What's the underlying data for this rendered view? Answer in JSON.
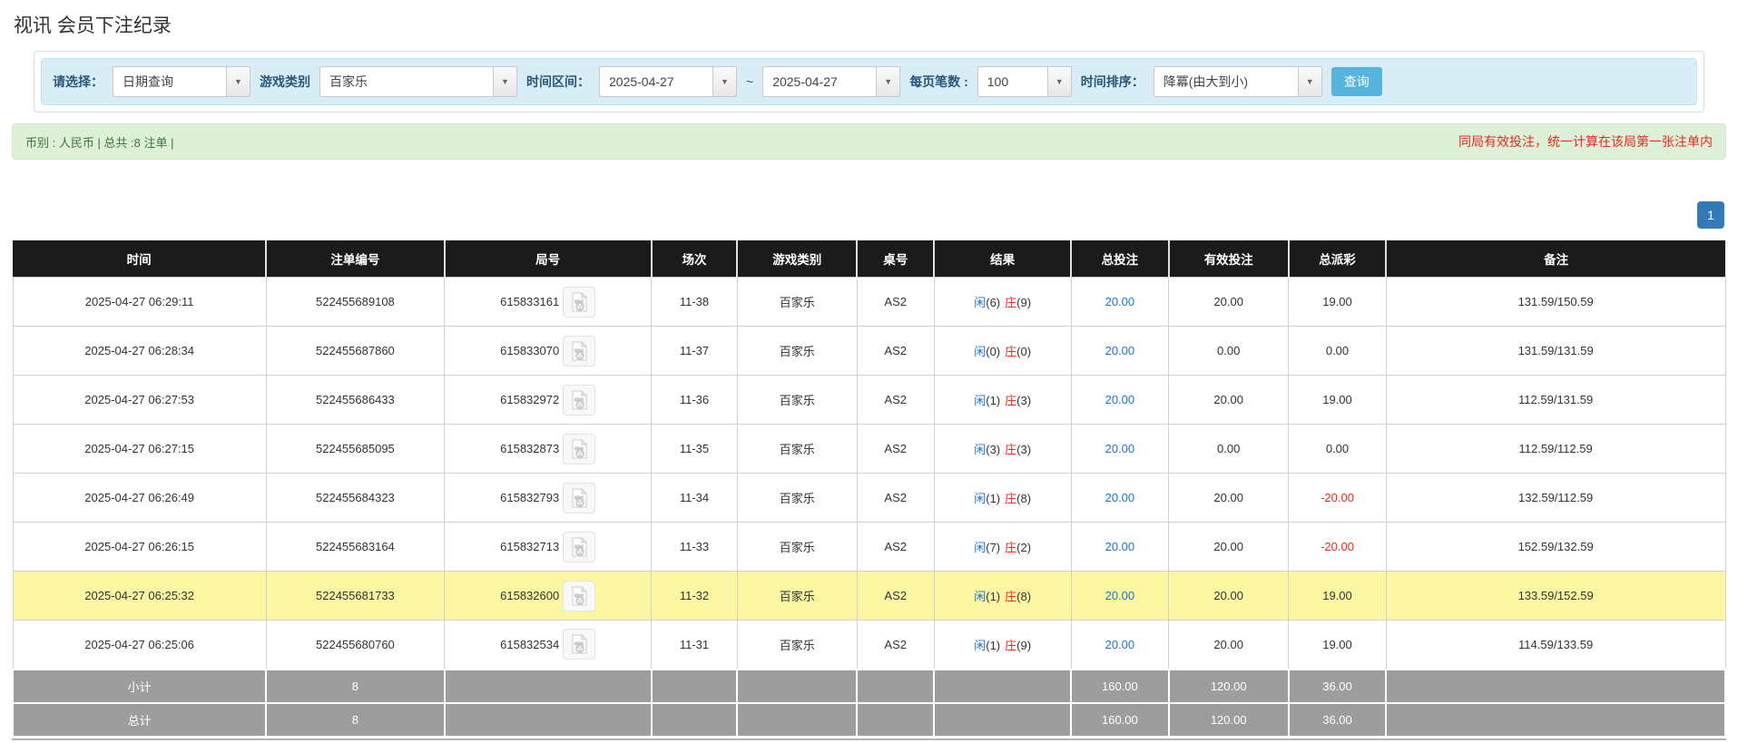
{
  "page": {
    "title": "视讯 会员下注纪录"
  },
  "filters": {
    "select_label": "请选择：",
    "select_value": "日期查询",
    "game_type_label": "游戏类别",
    "game_type_value": "百家乐",
    "time_range_label": "时间区间：",
    "date_from": "2025-04-27",
    "range_separator": "~",
    "date_to": "2025-04-27",
    "page_size_label": "每页笔数 :",
    "page_size_value": "100",
    "sort_label": "时间排序：",
    "sort_value": "降冪(由大到小)",
    "search_button": "查询",
    "dropdown_arrow": "▼"
  },
  "summary": {
    "left": "币别 : 人民币 | 总共 :8 注单 |",
    "right": "同局有效投注，统一计算在该局第一张注单内"
  },
  "pagination": {
    "current": "1"
  },
  "table": {
    "headers": [
      "时间",
      "注单编号",
      "局号",
      "场次",
      "游戏类别",
      "桌号",
      "结果",
      "总投注",
      "有效投注",
      "总派彩",
      "备注"
    ],
    "rows": [
      {
        "time": "2025-04-27 06:29:11",
        "bet_id": "522455689108",
        "round_id": "615833161",
        "session": "11-38",
        "game": "百家乐",
        "table_no": "AS2",
        "player": "闲",
        "player_score": "(6)",
        "banker": "庄",
        "banker_score": "(9)",
        "total_bet": "20.00",
        "valid_bet": "20.00",
        "payout": "19.00",
        "payout_negative": false,
        "remark": "131.59/150.59",
        "highlight": false
      },
      {
        "time": "2025-04-27 06:28:34",
        "bet_id": "522455687860",
        "round_id": "615833070",
        "session": "11-37",
        "game": "百家乐",
        "table_no": "AS2",
        "player": "闲",
        "player_score": "(0)",
        "banker": "庄",
        "banker_score": "(0)",
        "total_bet": "20.00",
        "valid_bet": "0.00",
        "payout": "0.00",
        "payout_negative": false,
        "remark": "131.59/131.59",
        "highlight": false
      },
      {
        "time": "2025-04-27 06:27:53",
        "bet_id": "522455686433",
        "round_id": "615832972",
        "session": "11-36",
        "game": "百家乐",
        "table_no": "AS2",
        "player": "闲",
        "player_score": "(1)",
        "banker": "庄",
        "banker_score": "(3)",
        "total_bet": "20.00",
        "valid_bet": "20.00",
        "payout": "19.00",
        "payout_negative": false,
        "remark": "112.59/131.59",
        "highlight": false
      },
      {
        "time": "2025-04-27 06:27:15",
        "bet_id": "522455685095",
        "round_id": "615832873",
        "session": "11-35",
        "game": "百家乐",
        "table_no": "AS2",
        "player": "闲",
        "player_score": "(3)",
        "banker": "庄",
        "banker_score": "(3)",
        "total_bet": "20.00",
        "valid_bet": "0.00",
        "payout": "0.00",
        "payout_negative": false,
        "remark": "112.59/112.59",
        "highlight": false
      },
      {
        "time": "2025-04-27 06:26:49",
        "bet_id": "522455684323",
        "round_id": "615832793",
        "session": "11-34",
        "game": "百家乐",
        "table_no": "AS2",
        "player": "闲",
        "player_score": "(1)",
        "banker": "庄",
        "banker_score": "(8)",
        "total_bet": "20.00",
        "valid_bet": "20.00",
        "payout": "-20.00",
        "payout_negative": true,
        "remark": "132.59/112.59",
        "highlight": false
      },
      {
        "time": "2025-04-27 06:26:15",
        "bet_id": "522455683164",
        "round_id": "615832713",
        "session": "11-33",
        "game": "百家乐",
        "table_no": "AS2",
        "player": "闲",
        "player_score": "(7)",
        "banker": "庄",
        "banker_score": "(2)",
        "total_bet": "20.00",
        "valid_bet": "20.00",
        "payout": "-20.00",
        "payout_negative": true,
        "remark": "152.59/132.59",
        "highlight": false
      },
      {
        "time": "2025-04-27 06:25:32",
        "bet_id": "522455681733",
        "round_id": "615832600",
        "session": "11-32",
        "game": "百家乐",
        "table_no": "AS2",
        "player": "闲",
        "player_score": "(1)",
        "banker": "庄",
        "banker_score": "(8)",
        "total_bet": "20.00",
        "valid_bet": "20.00",
        "payout": "19.00",
        "payout_negative": false,
        "remark": "133.59/152.59",
        "highlight": true
      },
      {
        "time": "2025-04-27 06:25:06",
        "bet_id": "522455680760",
        "round_id": "615832534",
        "session": "11-31",
        "game": "百家乐",
        "table_no": "AS2",
        "player": "闲",
        "player_score": "(1)",
        "banker": "庄",
        "banker_score": "(9)",
        "total_bet": "20.00",
        "valid_bet": "20.00",
        "payout": "19.00",
        "payout_negative": false,
        "remark": "114.59/133.59",
        "highlight": false
      }
    ],
    "footer": [
      {
        "label": "小计",
        "count": "8",
        "total_bet": "160.00",
        "valid_bet": "120.00",
        "payout": "36.00"
      },
      {
        "label": "总计",
        "count": "8",
        "total_bet": "160.00",
        "valid_bet": "120.00",
        "payout": "36.00"
      }
    ]
  },
  "colors": {
    "accent-blue": "#56b4dd",
    "pagination-blue": "#337ab7",
    "link-blue": "#1b74d1",
    "danger-red": "#e8291c",
    "header-bg": "#1b1b1b",
    "footer-bg": "#9d9d9d",
    "highlight-yellow": "#fbf6a2",
    "filter-bg": "#d9edf7",
    "filter-border": "#bce8f1",
    "summary-bg": "#dff0d8",
    "summary-border": "#d6e9c6",
    "summary-text": "#3c763d",
    "label-blue": "#2a5878"
  }
}
